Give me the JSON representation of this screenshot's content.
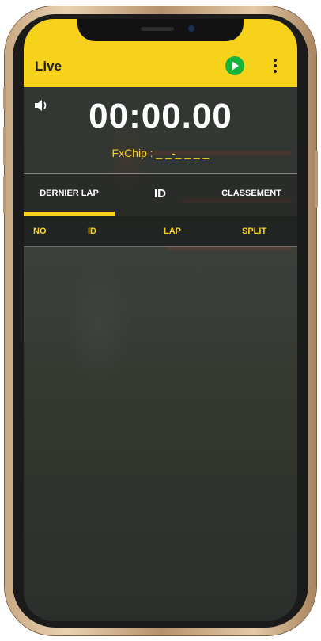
{
  "app": {
    "title": "Live"
  },
  "timer": {
    "value": "00:00.00",
    "chip_label": "FxChip : _ _-_ _ _ _"
  },
  "tabs": [
    {
      "label": "DERNIER LAP",
      "active": true
    },
    {
      "label": "ID",
      "active": false
    },
    {
      "label": "CLASSEMENT",
      "active": false
    }
  ],
  "table": {
    "columns": [
      "NO",
      "ID",
      "LAP",
      "SPLIT"
    ],
    "rows": []
  },
  "icons": {
    "sound": "speaker-icon",
    "play": "play-icon",
    "menu": "more-vertical-icon"
  },
  "colors": {
    "accent": "#f6d21a",
    "play": "#18b33b"
  }
}
